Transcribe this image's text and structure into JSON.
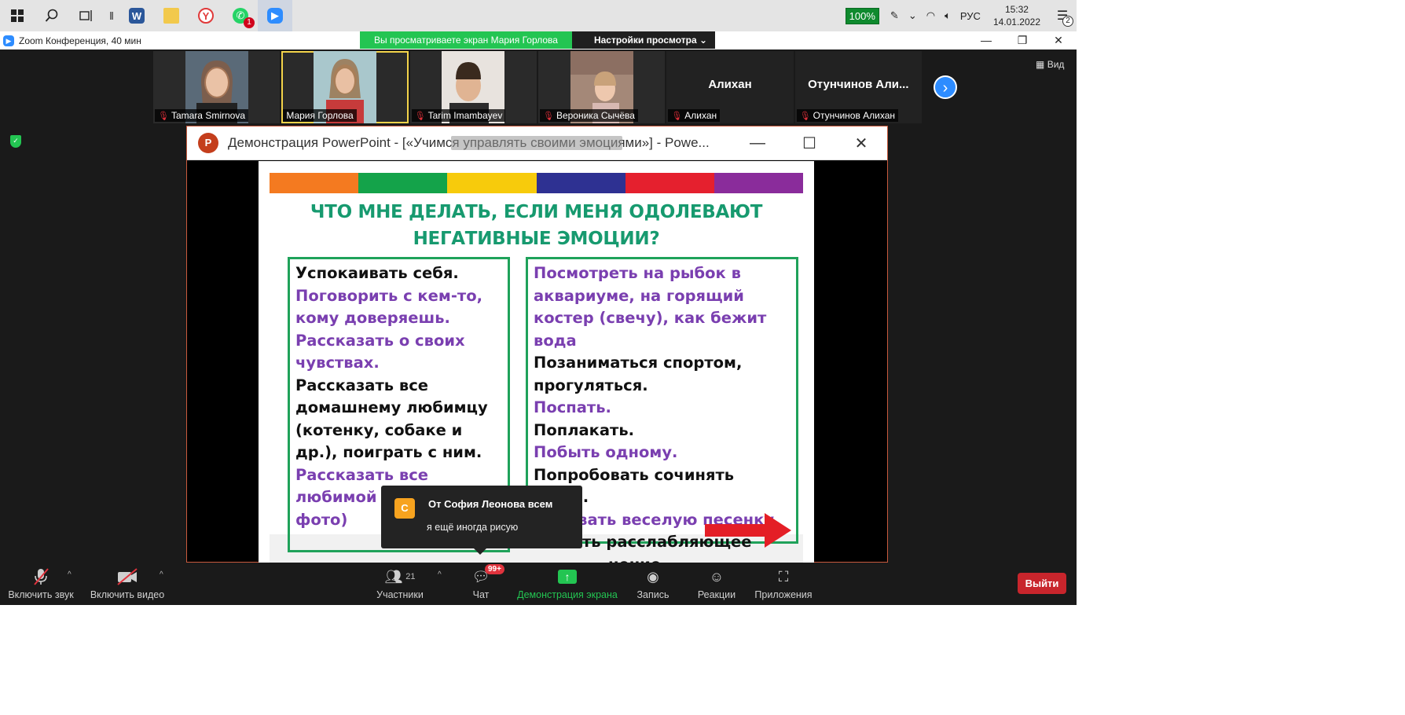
{
  "taskbar": {
    "apps": [
      "start",
      "search",
      "task-view",
      "separator",
      "word",
      "explorer",
      "yandex-browser",
      "whatsapp",
      "zoom"
    ],
    "whatsapp_badge": "1",
    "battery": "100%",
    "language": "РУС",
    "time": "15:32",
    "date": "14.01.2022",
    "notifications": "2"
  },
  "window": {
    "title": "Zoom Конференция, 40 мин",
    "viewing_banner": "Вы просматриваете экран Мария Горлова",
    "view_options": "Настройки просмотра",
    "view_button": "Вид"
  },
  "participants": [
    {
      "name": "Tamara Smirnova",
      "muted": true,
      "video": true
    },
    {
      "name": "Мария Горлова",
      "muted": false,
      "video": true,
      "active": true
    },
    {
      "name": "Tarim Imambayev",
      "muted": true,
      "video": true
    },
    {
      "name": "Вероника Сычёва",
      "muted": true,
      "video": true
    },
    {
      "name": "Алихан",
      "display": "Алихан",
      "muted": true,
      "video": false
    },
    {
      "name": "Отунчинов Алихан",
      "display": "Отунчинов  Али...",
      "muted": true,
      "video": false
    }
  ],
  "shared_window": {
    "title": "Демонстрация PowerPoint - [«Учимся управлять своими эмоциями»] - Powe...",
    "logo": "P"
  },
  "slide": {
    "title_line1": "ЧТО МНЕ ДЕЛАТЬ, ЕСЛИ МЕНЯ ОДОЛЕВАЮТ",
    "title_line2": "НЕГАТИВНЫЕ ЭМОЦИИ?",
    "left_items": [
      {
        "text": "Успокаивать себя.",
        "color": "black"
      },
      {
        "text": "Поговорить с кем-то, кому доверяешь.",
        "color": "purple"
      },
      {
        "text": "Рассказать о своих чувствах.",
        "color": "purple"
      },
      {
        "text": "Рассказать все домашнему любимцу (котенку, собаке и др.), поиграть с ним.",
        "color": "black"
      },
      {
        "text": "Рассказать все любимой игрушке (ч",
        "color": "purple"
      },
      {
        "text": "фото)",
        "color": "purple"
      }
    ],
    "right_items": [
      {
        "text": "Посмотреть на рыбок в аквариуме, на горящий костер (свечу), как бежит вода",
        "color": "purple"
      },
      {
        "text": "Позаниматься спортом, прогуляться.",
        "color": "black"
      },
      {
        "text": "Поспать.",
        "color": "purple"
      },
      {
        "text": "Поплакать.",
        "color": "black"
      },
      {
        "text": "Побыть одному.",
        "color": "purple"
      },
      {
        "text": "Попробовать сочинять стихи.",
        "color": "black"
      },
      {
        "text": "Напевать веселую песенку.",
        "color": "purple"
      },
      {
        "text": "ть расслабляющее",
        "color": "black"
      },
      {
        "text": "нение.",
        "color": "black"
      }
    ],
    "rainbow_colors": [
      "#f47a20",
      "#14a34a",
      "#f7cb0c",
      "#2e3192",
      "#e5202e",
      "#8a2c9b"
    ],
    "colors": {
      "title": "#179a6f",
      "purple": "#7a3fb0",
      "border": "#1fa25a",
      "arrow": "#e41e26"
    }
  },
  "chat_toast": {
    "avatar": "С",
    "from": "От София Леонова всем",
    "message": "я ещё иногда рисую"
  },
  "toolbar": {
    "audio": "Включить звук",
    "video": "Включить видео",
    "participants": "Участники",
    "participants_count": "21",
    "chat": "Чат",
    "chat_badge": "99+",
    "share": "Демонстрация экрана",
    "record": "Запись",
    "reactions": "Реакции",
    "apps": "Приложения",
    "leave": "Выйти"
  }
}
